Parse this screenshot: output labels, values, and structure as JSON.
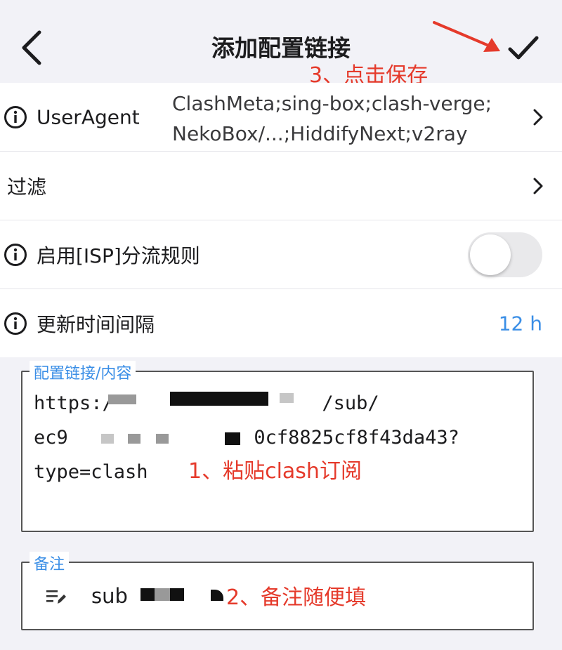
{
  "nav": {
    "title": "添加配置链接",
    "back_icon": "chevron-left-icon",
    "save_icon": "checkmark-icon"
  },
  "annotations": {
    "step3": "3、点击保存",
    "step1": "1、粘贴clash订阅",
    "step2": "2、备注随便填",
    "color": "#e53a2b"
  },
  "settings": {
    "user_agent": {
      "label": "UserAgent",
      "value_line1": "ClashMeta;sing-box;clash-verge;",
      "value_line2": "NekoBox/...;HiddifyNext;v2ray"
    },
    "filter": {
      "label": "过滤"
    },
    "isp_rules": {
      "label": "启用[ISP]分流规则",
      "enabled": false
    },
    "update_interval": {
      "label": "更新时间间隔",
      "value": "12 h"
    }
  },
  "link_field": {
    "legend": "配置链接/内容",
    "line1_start": "https:/",
    "line1_end": "/sub/",
    "line2_start": "ec9",
    "line2_end": "0cf8825cf8f43da43?",
    "line3": "type=clash"
  },
  "note_field": {
    "legend": "备注",
    "value_start": "sub"
  },
  "colors": {
    "accent": "#3a8ee6",
    "background": "#f2f2f7"
  }
}
